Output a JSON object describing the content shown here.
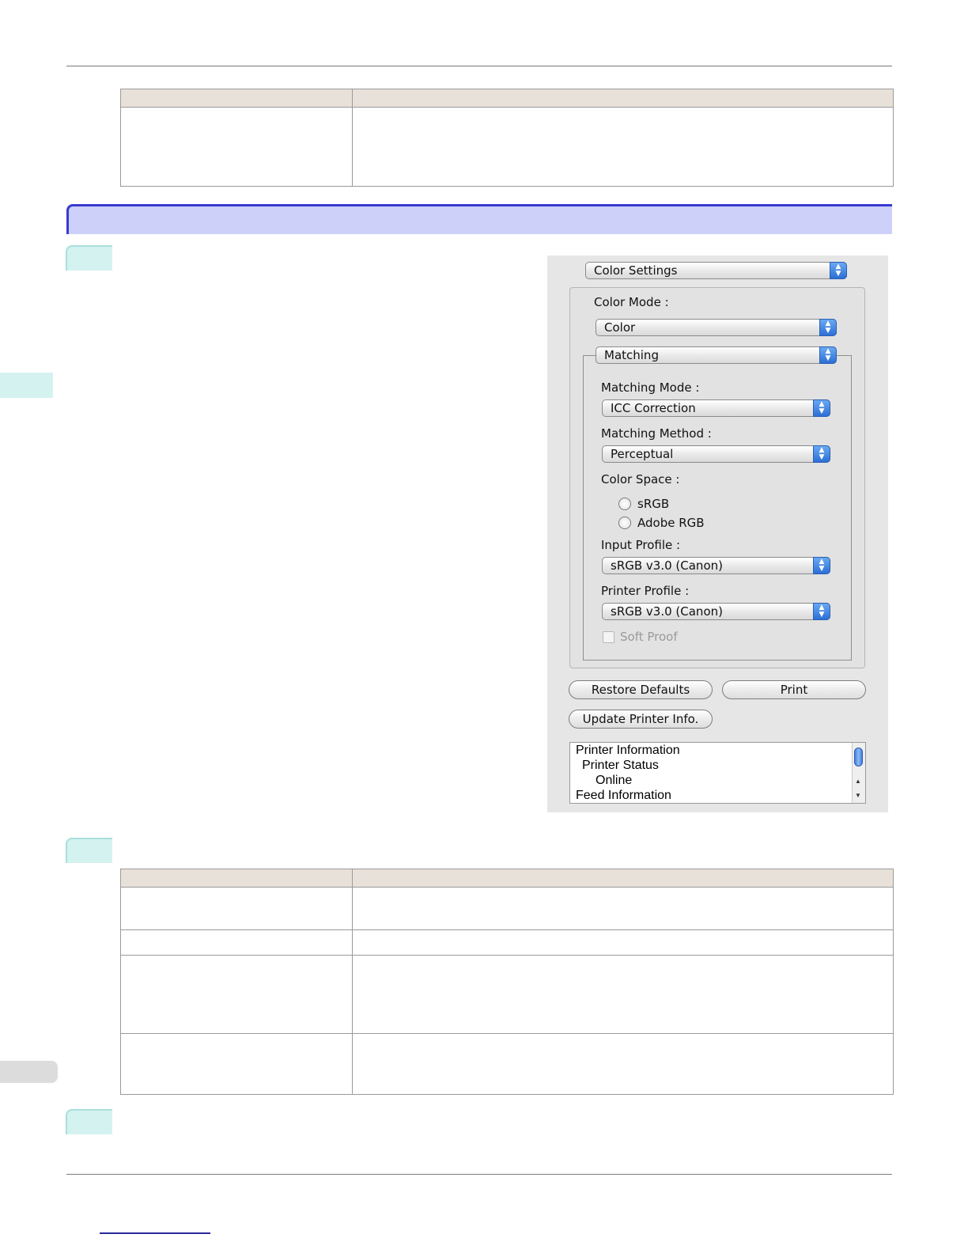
{
  "dialog": {
    "preset_popup": "Color Settings",
    "color_mode_label": "Color Mode :",
    "color_mode_value": "Color",
    "group_popup": "Matching",
    "matching_mode_label": "Matching Mode :",
    "matching_mode_value": "ICC Correction",
    "matching_method_label": "Matching Method :",
    "matching_method_value": "Perceptual",
    "color_space_label": "Color Space :",
    "radio_srgb": "sRGB",
    "radio_adobe_rgb": "Adobe RGB",
    "input_profile_label": "Input Profile :",
    "input_profile_value": "sRGB v3.0 (Canon)",
    "printer_profile_label": "Printer Profile :",
    "printer_profile_value": "sRGB v3.0 (Canon)",
    "soft_proof_label": "Soft Proof",
    "restore_defaults": "Restore Defaults",
    "print": "Print",
    "update_printer_info": "Update Printer Info.",
    "info_lines": [
      "Printer Information",
      "Printer Status",
      "Online",
      "Feed Information"
    ]
  },
  "icons": {
    "popup_arrow": "updown-arrows-icon",
    "scroll_up": "scroll-up-arrow-icon",
    "scroll_down": "scroll-down-arrow-icon"
  },
  "colors": {
    "section_band": "#cdd0f8",
    "section_border": "#3a3ad0",
    "step_tab": "#d4f2f0",
    "table_header": "#e8e1da",
    "popup_arrow": "#2c6fd6"
  }
}
